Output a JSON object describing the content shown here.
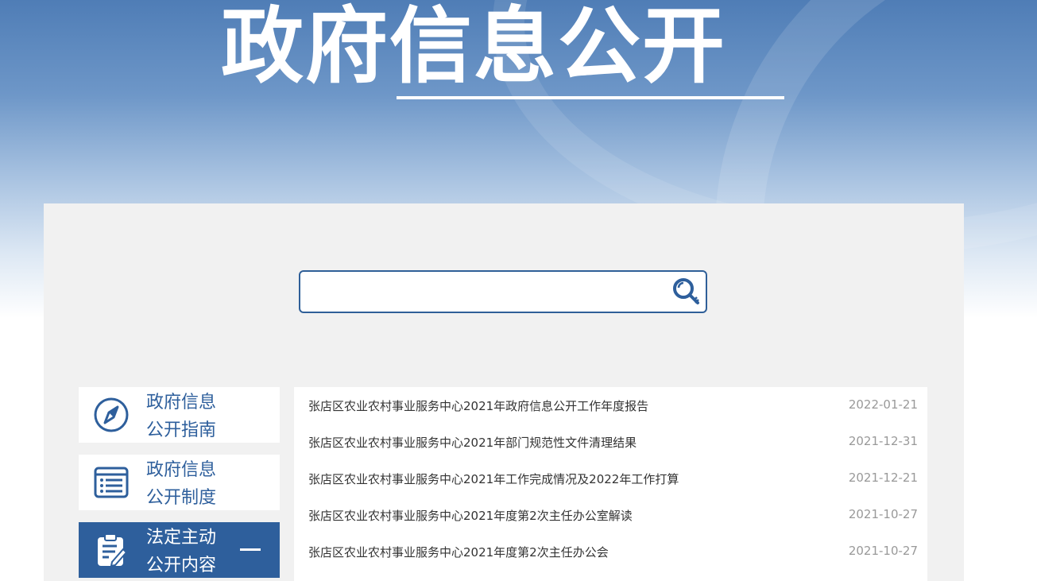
{
  "banner": {
    "title": "政府信息公开"
  },
  "search": {
    "placeholder": "",
    "value": "",
    "button_icon": "search-key-icon"
  },
  "sidebar": {
    "items": [
      {
        "line1": "政府信息",
        "line2": "公开指南",
        "icon": "compass-icon",
        "active": false
      },
      {
        "line1": "政府信息",
        "line2": "公开制度",
        "icon": "list-document-icon",
        "active": false
      },
      {
        "line1": "法定主动",
        "line2": "公开内容",
        "icon": "clipboard-edit-icon",
        "active": true
      }
    ]
  },
  "news": {
    "items": [
      {
        "title": "张店区农业农村事业服务中心2021年政府信息公开工作年度报告",
        "date": "2022-01-21"
      },
      {
        "title": "张店区农业农村事业服务中心2021年部门规范性文件清理结果",
        "date": "2021-12-31"
      },
      {
        "title": "张店区农业农村事业服务中心2021年工作完成情况及2022年工作打算",
        "date": "2021-12-21"
      },
      {
        "title": "张店区农业农村事业服务中心2021年度第2次主任办公室解读",
        "date": "2021-10-27"
      },
      {
        "title": "张店区农业农村事业服务中心2021年度第2次主任办公会",
        "date": "2021-10-27"
      }
    ]
  },
  "colors": {
    "primary": "#2e5f9c",
    "panel_bg": "#f1f1f1",
    "date_text": "#999999"
  }
}
